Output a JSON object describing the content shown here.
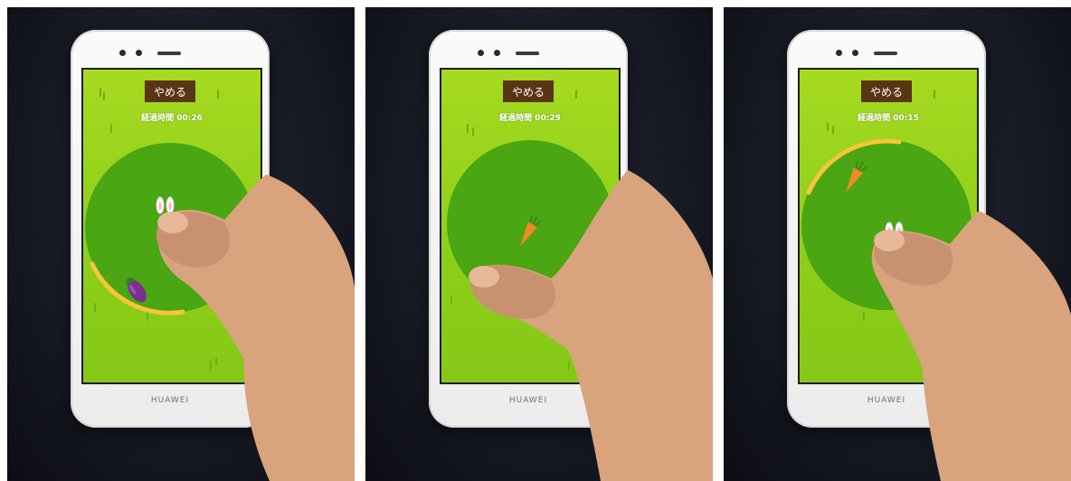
{
  "panels": [
    {
      "stop_label": "やめる",
      "elapsed_label": "経過時間",
      "elapsed_time": "00:26",
      "target_item": "eggplant-icon",
      "progress": 0.25,
      "brand": "HUAWEI"
    },
    {
      "stop_label": "やめる",
      "elapsed_label": "経過時間",
      "elapsed_time": "00:29",
      "target_item": "carrot-icon",
      "progress": 0,
      "brand": "HUAWEI"
    },
    {
      "stop_label": "やめる",
      "elapsed_label": "経過時間",
      "elapsed_time": "00:15",
      "target_item": "carrot-icon",
      "progress": 0.25,
      "brand": "HUAWEI"
    }
  ],
  "colors": {
    "screen_bg": "#a6da20",
    "circle": "#4aa612",
    "stop_button": "#5b3413",
    "progress_arc": "#f7c43a",
    "background": "#14161f"
  }
}
